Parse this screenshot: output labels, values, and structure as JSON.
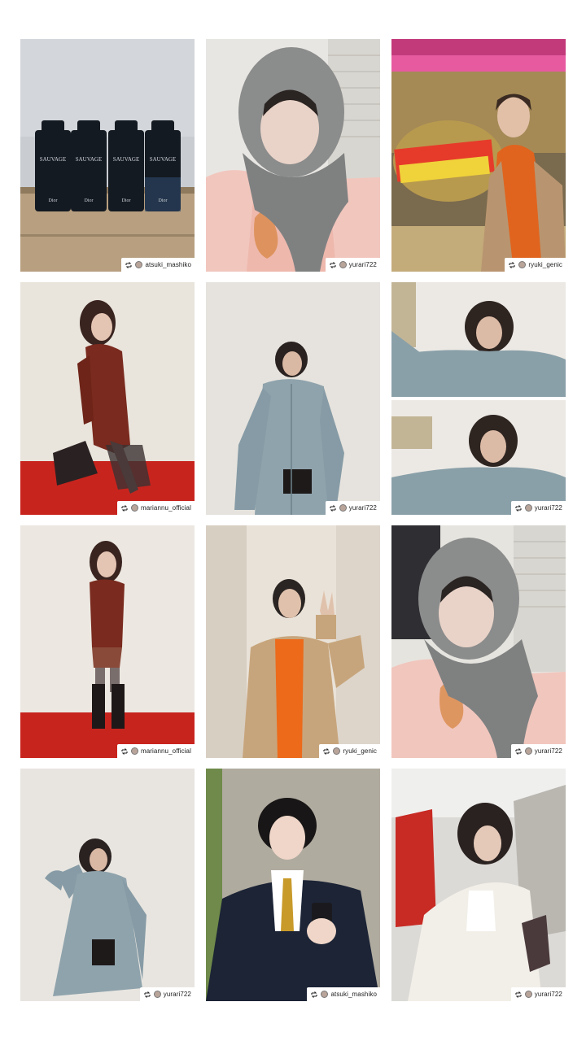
{
  "tiles": [
    {
      "credit": "atsuki_mashiko",
      "photo_icon": "perfume-bottles-photo",
      "bottle_label": "SAUVAGE",
      "bottle_brand": "Dior"
    },
    {
      "credit": "yurari722",
      "photo_icon": "hooded-scarf-selfie-photo"
    },
    {
      "credit": "ryuki_genic",
      "photo_icon": "stage-set-portrait-photo"
    },
    {
      "credit": "mariannu_official",
      "photo_icon": "red-dress-kneeling-photo"
    },
    {
      "credit": "yurari722",
      "photo_icon": "blue-shirt-standing-photo"
    },
    {
      "credit": "yurari722",
      "photo_icon": "blue-shirt-selfie-pair-photo"
    },
    {
      "credit": "mariannu_official",
      "photo_icon": "red-dress-standing-photo"
    },
    {
      "credit": "ryuki_genic",
      "photo_icon": "peace-sign-coat-photo"
    },
    {
      "credit": "yurari722",
      "photo_icon": "hooded-scarf-selfie-photo"
    },
    {
      "credit": "yurari722",
      "photo_icon": "blue-shirt-pose-photo"
    },
    {
      "credit": "atsuki_mashiko",
      "photo_icon": "blazer-holding-bottle-photo"
    },
    {
      "credit": "yurari722",
      "photo_icon": "white-blouse-selfie-photo"
    }
  ],
  "colors": {
    "background": "#ffffff",
    "credit_bg": "#ffffff",
    "credit_text": "#222222"
  }
}
